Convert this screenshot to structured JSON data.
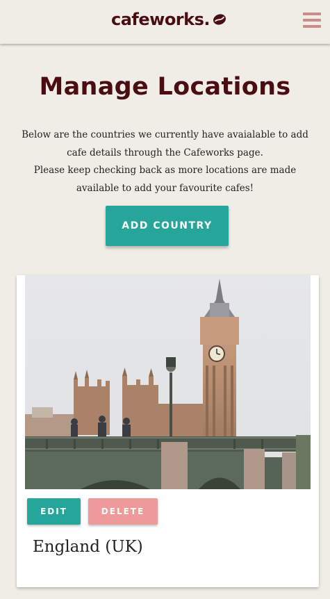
{
  "navbar": {
    "brand": "cafeworks.",
    "brand_icon": "coffee-bean-icon",
    "menu_icon": "hamburger-menu-icon"
  },
  "main": {
    "title": "Manage Locations",
    "intro_line_1": "Below are the countries we currently have avaialable to add cafe details through the Cafeworks page.",
    "intro_line_2": "Please keep checking back as more locations are made available to add your favourite cafes!",
    "add_button": "ADD COUNTRY"
  },
  "locations": [
    {
      "name": "England (UK)",
      "image": "big-ben-westminster-bridge-photo",
      "edit_label": "EDIT",
      "delete_label": "DELETE"
    }
  ],
  "colors": {
    "background": "#f0ede7",
    "brand": "#4a0e12",
    "primary_button": "#26a69a",
    "delete_button": "#ee9a9a",
    "menu_icon": "#c98c86"
  }
}
